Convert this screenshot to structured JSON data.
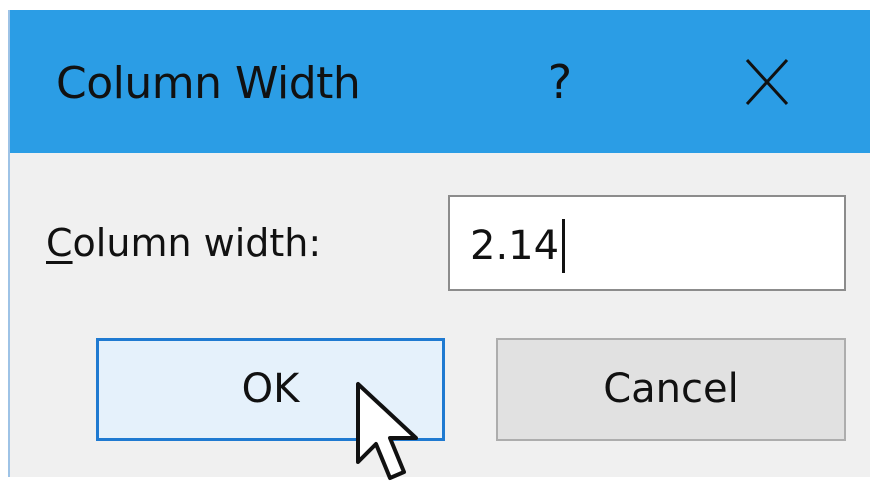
{
  "dialog": {
    "title": "Column Width",
    "help_glyph": "?",
    "close_icon": "close-icon",
    "titlebar_color": "#2b9de5"
  },
  "field": {
    "label_mnemonic": "C",
    "label_rest": "olumn width:",
    "value": "2.14"
  },
  "buttons": {
    "ok_label": "OK",
    "cancel_label": "Cancel",
    "ok_border_color": "#1f7ad1"
  },
  "pointer": {
    "icon": "arrow-cursor-icon"
  }
}
